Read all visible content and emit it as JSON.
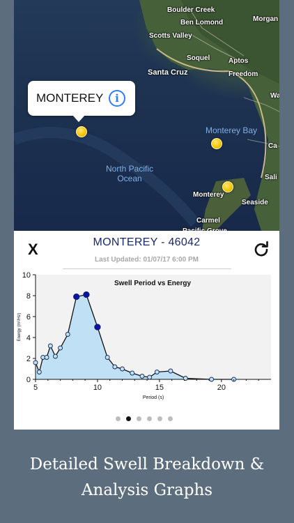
{
  "map": {
    "places": [
      {
        "name": "Boulder Creek"
      },
      {
        "name": "Ben Lomond"
      },
      {
        "name": "Morgan"
      },
      {
        "name": "Scotts Valley"
      },
      {
        "name": "Soquel"
      },
      {
        "name": "Aptos"
      },
      {
        "name": "Santa Cruz"
      },
      {
        "name": "Freedom"
      },
      {
        "name": "Wa"
      },
      {
        "name": "Ca"
      },
      {
        "name": "Sali"
      },
      {
        "name": "Monterey"
      },
      {
        "name": "Seaside"
      },
      {
        "name": "Carmel"
      },
      {
        "name": "Pacific Grove"
      }
    ],
    "water_labels": {
      "bay": "Monterey Bay",
      "ocean_line1": "North Pacific",
      "ocean_line2": "Ocean"
    },
    "callout": {
      "title": "MONTEREY",
      "icon": "info-icon"
    }
  },
  "panel": {
    "close_label": "X",
    "station_title": "MONTEREY - 46042",
    "last_updated": "Last Updated: 01/07/17 6:00 PM",
    "refresh_icon": "refresh-icon"
  },
  "chart_data": {
    "type": "area",
    "title": "Swell Period vs Energy",
    "xlabel": "Period (s)",
    "ylabel": "Energy (m²/Hz)",
    "xlim": [
      5,
      24
    ],
    "ylim": [
      0,
      10
    ],
    "xticks": [
      5,
      10,
      15,
      20
    ],
    "yticks": [
      0,
      2,
      4,
      6,
      8,
      10
    ],
    "grid": false,
    "x": [
      5.0,
      5.3,
      5.6,
      5.9,
      6.2,
      6.6,
      7.0,
      7.6,
      8.3,
      9.1,
      10.0,
      10.8,
      11.4,
      12.0,
      12.8,
      13.6,
      14.2,
      14.8,
      15.9,
      17.1,
      19.2,
      21.0
    ],
    "y": [
      1.6,
      0.7,
      2.1,
      2.1,
      3.2,
      2.2,
      3.0,
      4.3,
      7.9,
      8.1,
      5.0,
      2.1,
      1.2,
      1.0,
      0.6,
      0.3,
      0.2,
      0.7,
      0.8,
      0.1,
      0.0,
      0.0
    ],
    "highlighted_x": [
      8.3,
      9.1,
      10.0
    ],
    "fill_color": "#bfe0f5",
    "line_color": "#111111",
    "marker_color": "#bfe0f5",
    "highlight_color": "#0a12a8",
    "plot_background": "#f2f2f2"
  },
  "pager": {
    "count": 6,
    "active": 1
  },
  "caption": {
    "line1": "Detailed Swell Breakdown &",
    "line2": "Analysis Graphs"
  },
  "colors": {
    "page_background": "#5c6e7e",
    "title_color": "#1a2870",
    "pin_color": "#f5c800"
  }
}
